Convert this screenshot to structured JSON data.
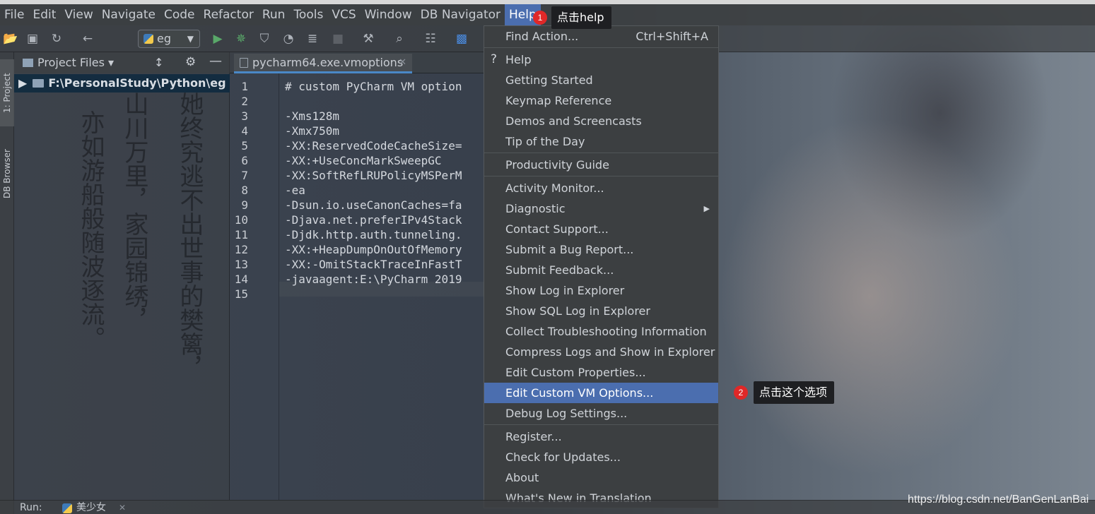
{
  "menubar": {
    "items": [
      "File",
      "Edit",
      "View",
      "Navigate",
      "Code",
      "Refactor",
      "Run",
      "Tools",
      "VCS",
      "Window",
      "DB Navigator",
      "Help"
    ]
  },
  "toolbar": {
    "run_config": "eg",
    "icons": [
      "open-folder-icon",
      "save-icon",
      "sync-icon",
      "back-arrow-icon",
      "run-icon",
      "debug-icon",
      "coverage-icon",
      "profile-icon",
      "concurrency-icon",
      "stop-icon",
      "settings-wrench-icon",
      "search-icon",
      "structure-icon",
      "translate-icon"
    ]
  },
  "side_tabs": {
    "project": "1: Project",
    "db_browser": "DB Browser"
  },
  "project_panel": {
    "title": "Project Files",
    "root_path": "F:\\PersonalStudy\\Python\\eg"
  },
  "poem": {
    "col1": "她终究逃不出世事的樊篱，",
    "col2": "山川万里，家园锦绣，",
    "col3": "亦如游船般随波逐流。"
  },
  "editor": {
    "tab_label": "pycharm64.exe.vmoptions",
    "lines": [
      "# custom PyCharm VM option",
      "",
      "-Xms128m",
      "-Xmx750m",
      "-XX:ReservedCodeCacheSize=",
      "-XX:+UseConcMarkSweepGC",
      "-XX:SoftRefLRUPolicyMSPerM",
      "-ea",
      "-Dsun.io.useCanonCaches=fa",
      "-Djava.net.preferIPv4Stack",
      "-Djdk.http.auth.tunneling.",
      "-XX:+HeapDumpOnOutOfMemory",
      "-XX:-OmitStackTraceInFastT",
      "-javaagent:E:\\PyCharm 2019",
      ""
    ],
    "line_numbers": [
      "1",
      "2",
      "3",
      "4",
      "5",
      "6",
      "7",
      "8",
      "9",
      "10",
      "11",
      "12",
      "13",
      "14",
      "15"
    ]
  },
  "help_menu": {
    "find_action": "Find Action...",
    "find_action_shortcut": "Ctrl+Shift+A",
    "help": "Help",
    "getting_started": "Getting Started",
    "keymap_reference": "Keymap Reference",
    "demos": "Demos and Screencasts",
    "tip": "Tip of the Day",
    "productivity": "Productivity Guide",
    "activity_monitor": "Activity Monitor...",
    "diagnostic": "Diagnostic",
    "contact_support": "Contact Support...",
    "submit_bug": "Submit a Bug Report...",
    "submit_feedback": "Submit Feedback...",
    "show_log": "Show Log in Explorer",
    "show_sql_log": "Show SQL Log in Explorer",
    "collect_info": "Collect Troubleshooting Information",
    "compress_logs": "Compress Logs and Show in Explorer",
    "edit_props": "Edit Custom Properties...",
    "edit_vm": "Edit Custom VM Options...",
    "debug_log": "Debug Log Settings...",
    "register": "Register...",
    "check_updates": "Check for Updates...",
    "about": "About",
    "whats_new": "What's New in Translation"
  },
  "callouts": {
    "step1_num": "1",
    "step1_text": "点击help",
    "step2_num": "2",
    "step2_text": "点击这个选项"
  },
  "bottom": {
    "run_label": "Run:",
    "run_tab": "美少女"
  },
  "watermark": "https://blog.csdn.net/BanGenLanBai",
  "colors": {
    "menu_bg": "#3c3f41",
    "selection": "#4b6eaf",
    "badge": "#e02828",
    "callout_bg": "#1e1f22"
  }
}
